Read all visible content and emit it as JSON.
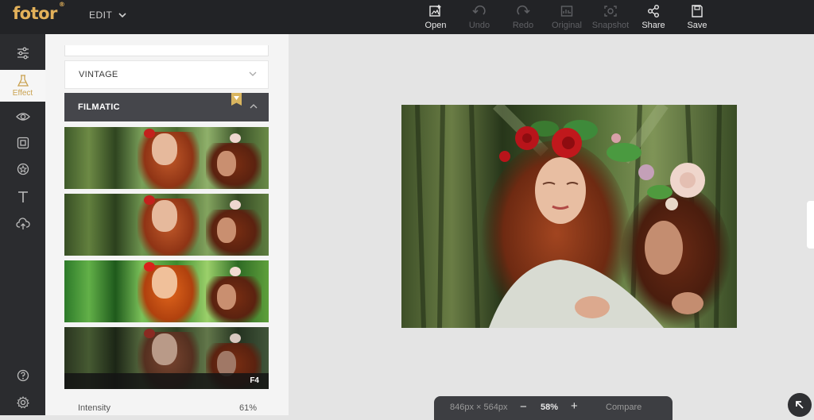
{
  "app": {
    "logo": "fotor",
    "logo_mark": "®",
    "menu_label": "EDIT"
  },
  "toolbar": [
    {
      "label": "Open",
      "icon": "open-image-icon",
      "enabled": true
    },
    {
      "label": "Undo",
      "icon": "undo-icon",
      "enabled": false
    },
    {
      "label": "Redo",
      "icon": "redo-icon",
      "enabled": false
    },
    {
      "label": "Original",
      "icon": "original-icon",
      "enabled": false
    },
    {
      "label": "Snapshot",
      "icon": "snapshot-icon",
      "enabled": false
    },
    {
      "label": "Share",
      "icon": "share-icon",
      "enabled": true
    },
    {
      "label": "Save",
      "icon": "save-icon",
      "enabled": true
    }
  ],
  "rail": [
    {
      "icon": "adjust-sliders-icon"
    },
    {
      "icon": "flask-icon",
      "label": "Effect",
      "active": true
    },
    {
      "icon": "eye-icon"
    },
    {
      "icon": "frame-icon"
    },
    {
      "icon": "sticker-icon"
    },
    {
      "icon": "text-icon"
    },
    {
      "icon": "cloud-upload-icon"
    },
    {
      "icon": "help-icon"
    },
    {
      "icon": "settings-icon"
    }
  ],
  "panel": {
    "categories": [
      {
        "label": "VINTAGE",
        "expanded": false
      },
      {
        "label": "FILMATIC",
        "expanded": true,
        "premium": true
      }
    ],
    "filters": [
      {
        "label": "",
        "tint": "warm"
      },
      {
        "label": "",
        "tint": "warm"
      },
      {
        "label": "",
        "tint": "vivid"
      },
      {
        "label": "F4",
        "tint": "dark"
      }
    ],
    "intensity": {
      "label": "Intensity",
      "value": "61%"
    }
  },
  "canvas": {
    "size_text": "846px × 564px",
    "zoom_out": "−",
    "zoom": "58%",
    "zoom_in": "+",
    "compare": "Compare"
  },
  "colors": {
    "accent": "#d9b55f",
    "topbar": "#222326",
    "rail": "#2b2c2f"
  }
}
